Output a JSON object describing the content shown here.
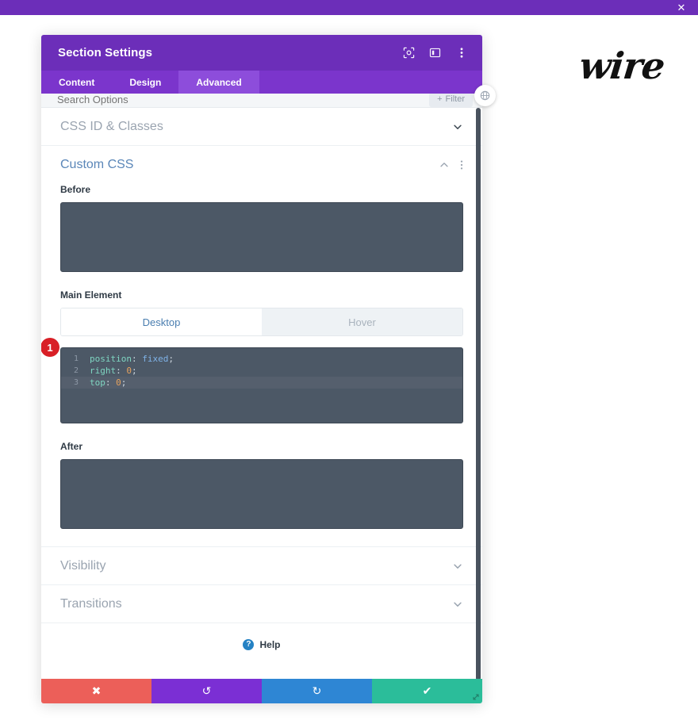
{
  "top_bar": {
    "close_label": "✕",
    "bg": "#6c2eb9"
  },
  "site": {
    "logo_text": "wire"
  },
  "modal": {
    "title": "Section Settings",
    "header_icons": [
      {
        "name": "focus-target-icon",
        "label": ""
      },
      {
        "name": "layout-panel-icon",
        "label": ""
      },
      {
        "name": "vertical-dots-icon",
        "label": ""
      }
    ],
    "tabs": [
      {
        "label": "Content",
        "active": false
      },
      {
        "label": "Design",
        "active": false
      },
      {
        "label": "Advanced",
        "active": true
      }
    ],
    "search": {
      "placeholder": "Search Options",
      "value": "",
      "filter_label": "Filter",
      "filter_plus": "+"
    },
    "sections": [
      {
        "label": "CSS ID & Classes",
        "state": "collapsed"
      },
      {
        "label": "Custom CSS",
        "state": "expanded"
      },
      {
        "label": "Visibility",
        "state": "collapsed"
      },
      {
        "label": "Transitions",
        "state": "collapsed"
      }
    ],
    "custom_css": {
      "title": "Custom CSS",
      "before": {
        "label": "Before",
        "value": ""
      },
      "main_element": {
        "label": "Main Element",
        "device_tabs": [
          {
            "label": "Desktop",
            "active": true
          },
          {
            "label": "Hover",
            "active": false
          }
        ],
        "badge": "1",
        "code_lines": [
          {
            "num": "1",
            "prop": "position",
            "colon": ":",
            "value": "fixed",
            "value_type": "keyword",
            "semi": ";",
            "active": false
          },
          {
            "num": "2",
            "prop": "right",
            "colon": ":",
            "value": "0",
            "value_type": "number",
            "semi": ";",
            "active": false
          },
          {
            "num": "3",
            "prop": "top",
            "colon": ":",
            "value": "0",
            "value_type": "number",
            "semi": ";",
            "active": true
          }
        ]
      },
      "after": {
        "label": "After",
        "value": ""
      }
    },
    "help": {
      "icon_label": "?",
      "label": "Help"
    },
    "footer": [
      {
        "name": "cancel-button",
        "glyph": "✖",
        "color": "#ec5f59"
      },
      {
        "name": "undo-button",
        "glyph": "↺",
        "color": "#7b2fd4"
      },
      {
        "name": "redo-button",
        "glyph": "↻",
        "color": "#2e86d4"
      },
      {
        "name": "save-button",
        "glyph": "✔",
        "color": "#2bbd9a"
      }
    ]
  }
}
